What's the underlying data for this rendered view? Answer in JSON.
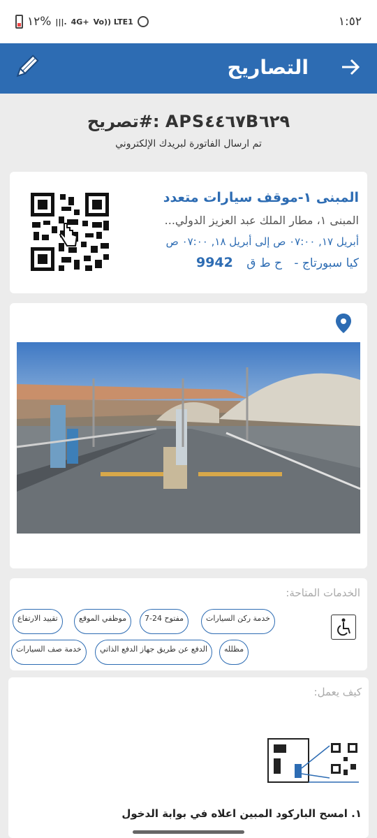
{
  "status": {
    "time": "١:٥٢",
    "battery": "١٢%",
    "network": "4G+",
    "lte": "Vo)) LTE1"
  },
  "header": {
    "title": "التصاريح",
    "back_icon": "arrow-right-icon",
    "edit_icon": "pencil-icon"
  },
  "permit": {
    "number": "تصريح#: APS٤٤٦٧B٦٢٩",
    "invoice_note": "تم ارسال الفاتورة لبريدك الإلكتروني"
  },
  "parking": {
    "name": "المبنى ١-موقف سيارات متعدد",
    "address": "المبنى ١، مطار الملك عبد العزيز الدولي...",
    "dates": "أبريل ١٧, ٠٧:٠٠ ص إلى أبريل ١٨, ٠٧:٠٠ ص",
    "vehicle": "كيا سبورتاج -",
    "plate_letters": "ح ط ق",
    "plate_number": "9942"
  },
  "location_icon": "map-pin-icon",
  "services": {
    "title": "الخدمات المتاحة:",
    "items": [
      "خدمة ركن السيارات",
      "مفتوح 24-7",
      "موظفي الموقع",
      "تقييد الارتفاع",
      "مظلله",
      "الدفع عن طريق جهاز الدفع الذاتي",
      "خدمة صف السيارات"
    ],
    "wheelchair_icon": "wheelchair-icon"
  },
  "how": {
    "title": "كيف يعمل:",
    "step1": "١. امسح الباركود المبين اعلاه في بوابة الدخول"
  },
  "colors": {
    "primary": "#2d6cb3",
    "background": "#ececec"
  }
}
